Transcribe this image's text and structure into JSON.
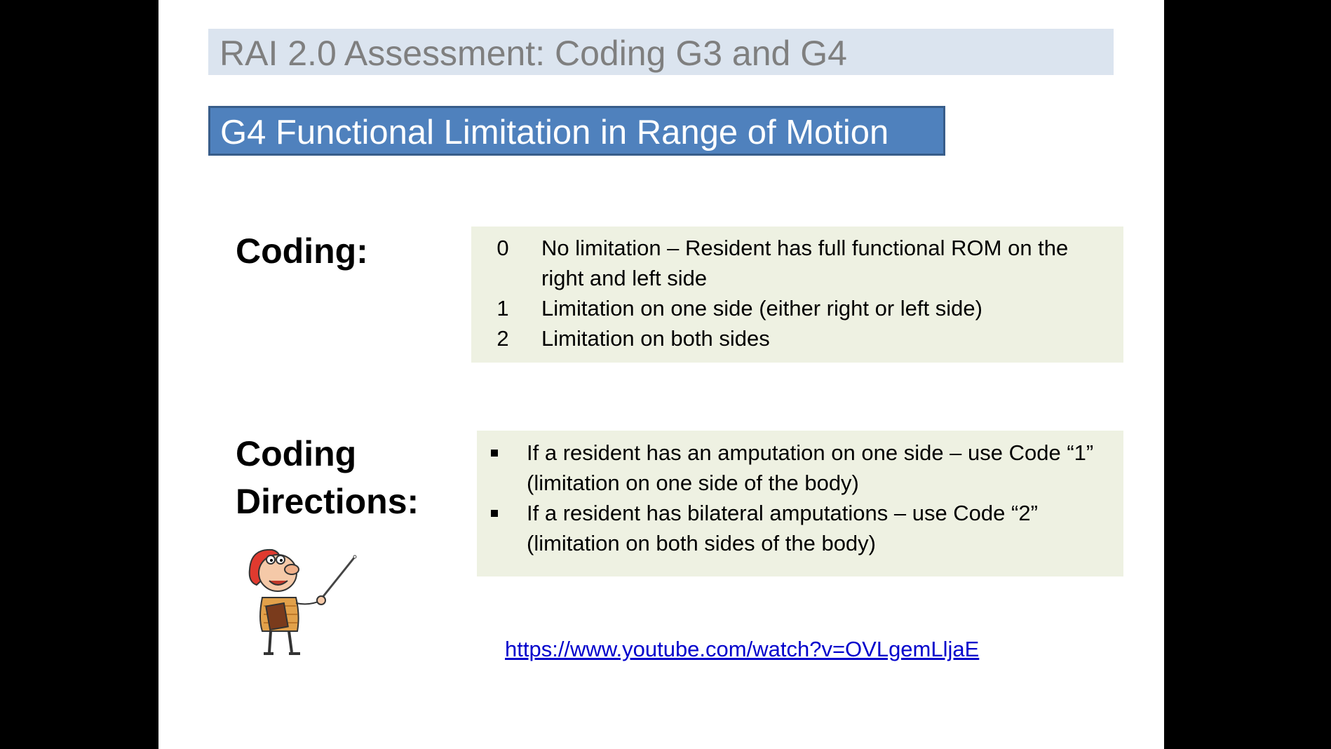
{
  "slide": {
    "header_title": "RAI 2.0 Assessment: Coding G3 and G4",
    "section_title": "G4  Functional Limitation in Range of Motion",
    "coding_label": "Coding:",
    "codes": [
      {
        "num": "0",
        "text": "No limitation – Resident has full functional ROM on the right and left side"
      },
      {
        "num": "1",
        "text": "Limitation on one side (either right or left side)"
      },
      {
        "num": "2",
        "text": "Limitation on both sides"
      }
    ],
    "directions_label": "Coding Directions:",
    "directions": [
      {
        "text": "If a resident has an amputation on one side – use Code “1” (limitation on one side of the body)"
      },
      {
        "text": "If a resident has bilateral amputations – use Code “2” (limitation on both sides of the body)"
      }
    ],
    "illustration": "teacher-with-pointer-cartoon",
    "link_text": "https://www.youtube.com/watch?v=OVLgemLljaE"
  },
  "colors": {
    "header_bg": "#dbe4ef",
    "header_text": "#7f7f7f",
    "section_bg": "#4f81bd",
    "box_bg": "#eef1e2",
    "link": "#0000cc"
  }
}
